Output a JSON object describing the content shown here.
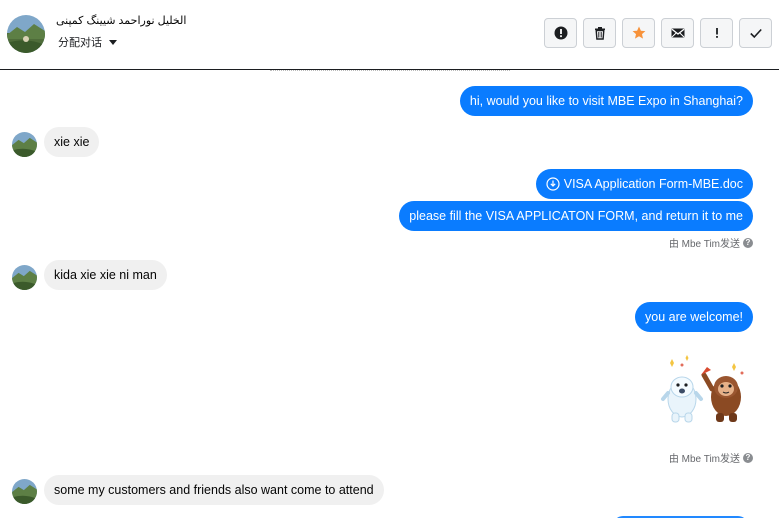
{
  "header": {
    "contact_name": "الخلیل نوراحمد شیینگ کمپنی",
    "assign_label": "分配对话",
    "actions": [
      {
        "name": "alert-button",
        "icon": "exclamation-circle-icon",
        "color": "#1c1e21"
      },
      {
        "name": "delete-button",
        "icon": "trash-icon",
        "color": "#1c1e21"
      },
      {
        "name": "star-button",
        "icon": "star-icon",
        "color": "#f7923a"
      },
      {
        "name": "mail-button",
        "icon": "mail-icon",
        "color": "#1c1e21"
      },
      {
        "name": "important-button",
        "icon": "exclamation-icon",
        "color": "#1c1e21"
      },
      {
        "name": "done-button",
        "icon": "check-icon",
        "color": "#1c1e21"
      }
    ]
  },
  "messages": {
    "m1": "hi, would you like to visit MBE Expo in Shanghai?",
    "m2": "xie xie",
    "m3_file": "VISA Application Form-MBE.doc",
    "m4": "please fill the VISA APPLICATON FORM, and return it to me",
    "sent_by_1": "由 Mbe Tim发送",
    "m5": "kida xie xie ni man",
    "m6": "you are welcome!",
    "sent_by_2": "由 Mbe Tim发送",
    "m7": "some my customers and friends also want come to attend"
  },
  "colors": {
    "outgoing_bubble": "#0a7cff",
    "incoming_bubble": "#f0f0f0",
    "accent_star": "#f7923a"
  }
}
